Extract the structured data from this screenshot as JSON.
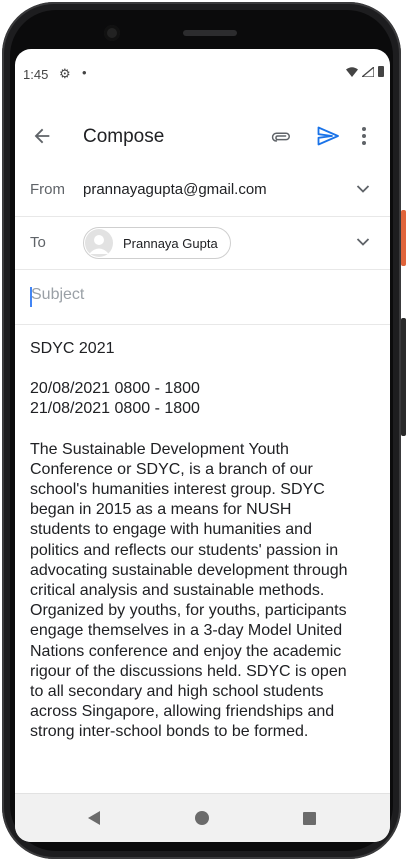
{
  "status": {
    "time": "1:45"
  },
  "appbar": {
    "title": "Compose"
  },
  "from": {
    "label": "From",
    "value": "prannayagupta@gmail.com"
  },
  "to": {
    "label": "To",
    "recipient": "Prannaya Gupta"
  },
  "subject": {
    "placeholder": "Subject",
    "value": ""
  },
  "body": {
    "line1": "SDYC 2021",
    "dates": [
      "20/08/2021 0800 - 1800",
      "21/08/2021 0800 - 1800"
    ],
    "lines": [
      "The Sustainable Development Youth",
      "Conference or SDYC, is a branch of our",
      "school's humanities interest group. SDYC",
      "began in 2015 as a means for NUSH",
      "students to engage with humanities and",
      "politics and reflects our students' passion in",
      "advocating sustainable development through",
      "critical analysis and sustainable methods.",
      "Organized by youths, for youths, participants",
      "engage themselves in a 3-day Model United",
      "Nations conference and enjoy the academic",
      "rigour of the discussions held. SDYC is open",
      "to all secondary and high school students",
      "across Singapore, allowing friendships and",
      "strong inter-school bonds to be formed."
    ]
  },
  "colors": {
    "accent": "#1a73e8",
    "cursor": "#4285f4"
  },
  "icons": [
    "back-arrow-icon",
    "attach-icon",
    "send-icon",
    "more-vert-icon",
    "chevron-down-icon",
    "avatar-icon",
    "settings-gear-icon",
    "wifi-icon",
    "signal-icon",
    "battery-icon"
  ]
}
